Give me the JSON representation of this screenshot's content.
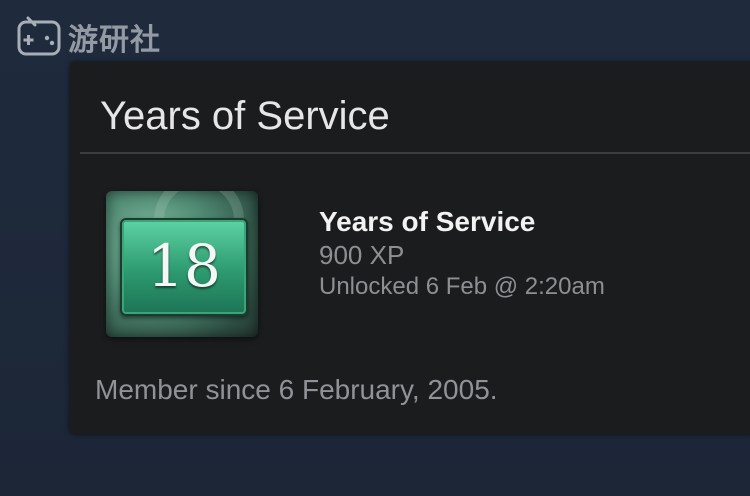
{
  "watermark": {
    "text": "游研社",
    "icon": "gamepad-face-icon"
  },
  "card": {
    "title": "Years of Service",
    "badge": {
      "number": "18",
      "icon": "years-of-service-badge-icon",
      "accent_color": "#3aa57b"
    },
    "achievement": {
      "name": "Years of Service",
      "xp": "900 XP",
      "unlocked": "Unlocked 6 Feb @ 2:20am"
    },
    "member_since": "Member since 6 February, 2005."
  },
  "colors": {
    "page_background": "#1e2a3b",
    "panel_background": "#1b1c1e",
    "title_text": "#e6e6e6",
    "muted_text": "#8d8f93"
  }
}
